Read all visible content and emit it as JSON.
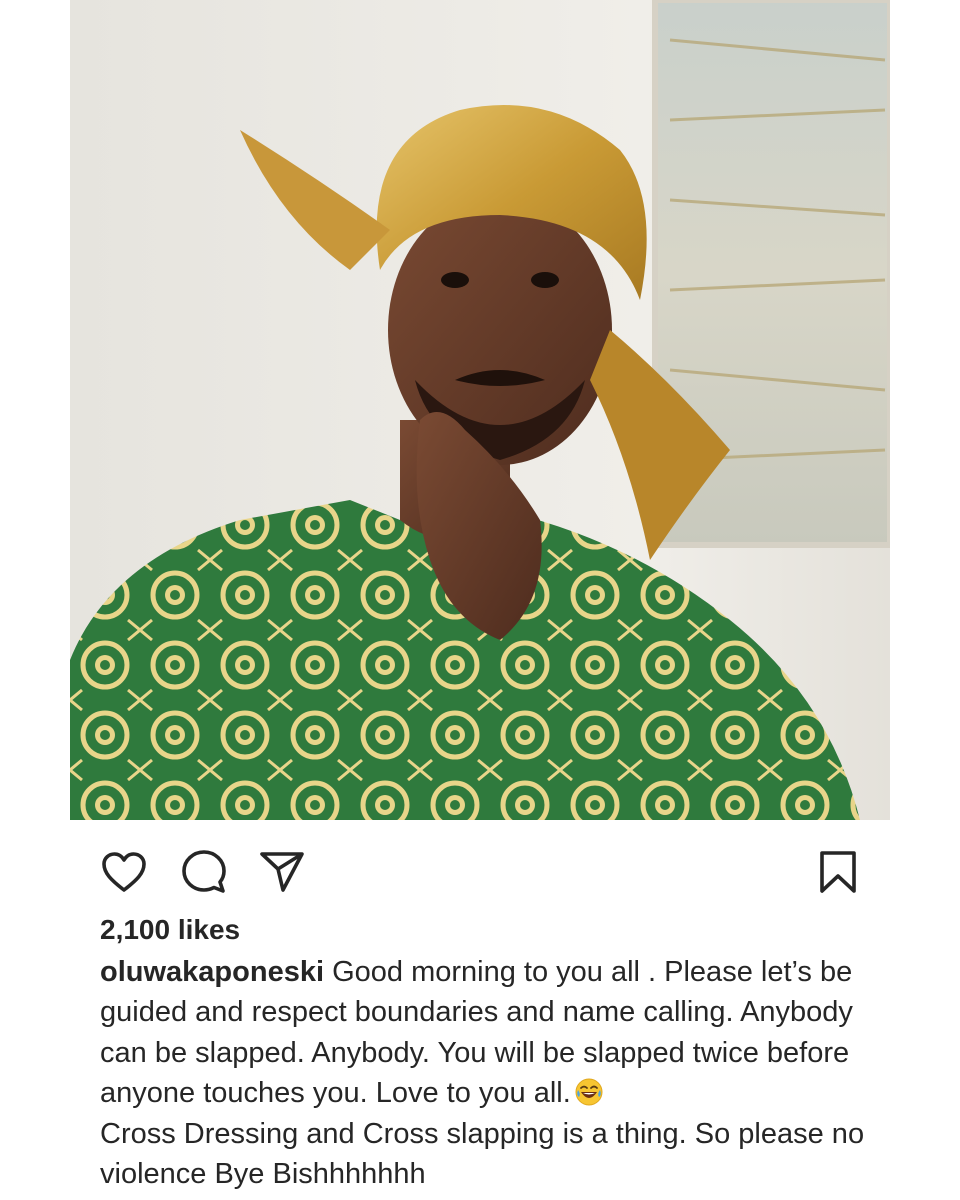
{
  "post": {
    "image_alt": "Man wearing a gold gele and green patterned outfit, hand on chin",
    "likes_text": "2,100 likes",
    "username": "oluwakaponeski",
    "caption_part1": "Good morning to you all . Please let’s be guided and respect boundaries and name calling. Anybody can be slapped. Anybody. You will be slapped twice before anyone touches you. Love to you all.",
    "caption_emoji": "face-with-tears-of-joy",
    "caption_part2": "Cross Dressing and Cross slapping is a thing. So please no violence Bye Bishhhhhhh"
  },
  "icons": {
    "like": "heart-icon",
    "comment": "comment-bubble-icon",
    "share": "paper-plane-icon",
    "save": "bookmark-icon"
  },
  "colors": {
    "text": "#262626",
    "background": "#ffffff",
    "icon_stroke": "#262626"
  }
}
